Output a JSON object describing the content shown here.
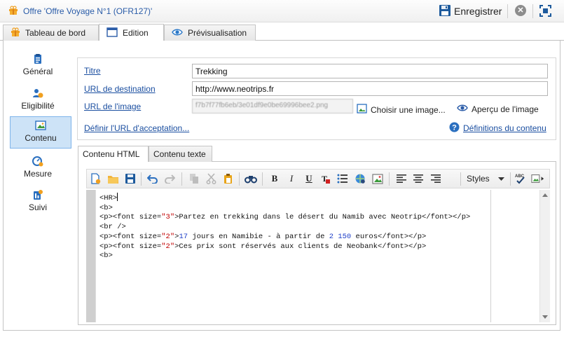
{
  "window": {
    "title": "Offre 'Offre Voyage N°1 (OFR127)'",
    "save_label": "Enregistrer"
  },
  "main_tabs": [
    {
      "label": "Tableau de bord",
      "icon": "gift-icon"
    },
    {
      "label": "Edition",
      "icon": "window-icon",
      "active": true
    },
    {
      "label": "Prévisualisation",
      "icon": "eye-icon"
    }
  ],
  "nav": [
    {
      "label": "Général",
      "icon": "clipboard-icon"
    },
    {
      "label": "Eligibilité",
      "icon": "users-icon"
    },
    {
      "label": "Contenu",
      "icon": "image-icon",
      "active": true
    },
    {
      "label": "Mesure",
      "icon": "gauge-icon"
    },
    {
      "label": "Suivi",
      "icon": "tracking-icon"
    }
  ],
  "form": {
    "titre_label": "Titre",
    "titre_value": "Trekking",
    "url_dest_label": "URL de destination",
    "url_dest_value": "http://www.neotrips.fr",
    "url_image_label": "URL de l'image",
    "url_image_value": "f7b7f77fb6eb/3e01df9e0be69996bee2.png",
    "choose_image": "Choisir une image...",
    "preview_image": "Aperçu de l'image",
    "accept_url_link": "Définir l'URL d'acceptation...",
    "content_defs_link": "Définitions du contenu"
  },
  "sub_tabs": [
    {
      "label": "Contenu HTML",
      "active": true
    },
    {
      "label": "Contenu texte"
    }
  ],
  "toolbar": {
    "styles_label": "Styles",
    "bold": "B",
    "italic": "I",
    "underline": "U"
  },
  "code": {
    "line1": "<HR>",
    "line2": "<b>",
    "line3a": "<p><font size=",
    "line3b": "\"3\"",
    "line3c": ">Partez en trekking dans le désert du Namib avec Neotrip</font></p>",
    "line4": "<br />",
    "line5a": "<p><font size=",
    "line5b": "\"2\"",
    "line5c": ">",
    "line5d": "17",
    "line5e": " jours en Namibie - à partir de ",
    "line5f": "2",
    "line5g": " ",
    "line5h": "150",
    "line5i": " euros</font></p>",
    "line6a": "<p><font size=",
    "line6b": "\"2\"",
    "line6c": ">Ces prix sont réservés aux clients de Neobank</font></p>",
    "line7": "<b>"
  },
  "colors": {
    "title_blue": "#2a5ca8",
    "link_blue": "#1a4ea0",
    "nav_active_bg": "#cde3f7",
    "code_red": "#c00000",
    "code_blue": "#1f3fc8"
  }
}
